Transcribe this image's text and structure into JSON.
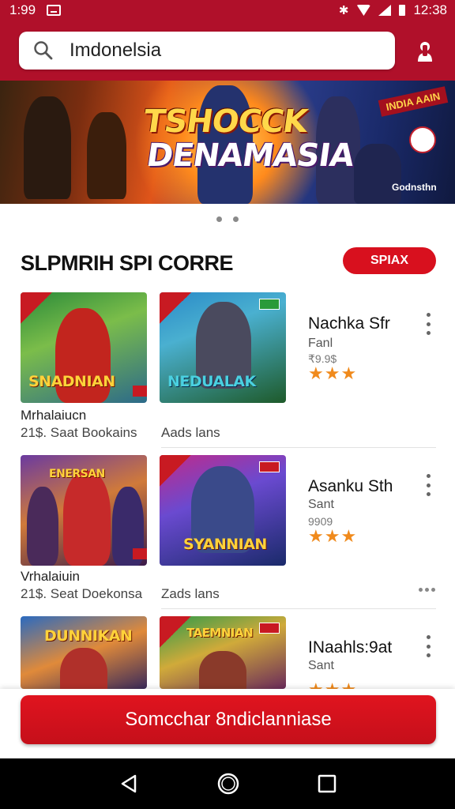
{
  "status_bar": {
    "time": "1:99",
    "right_time": "12:38"
  },
  "search": {
    "value": "Imdonelsia"
  },
  "banner": {
    "title": "TSHOCCK",
    "subtitle": "DENAMASIA",
    "tag": "INDIA AAIN",
    "logo": "Godnsthn"
  },
  "section": {
    "title": "SLPMRIH SPI CORRE",
    "button_label": "SPIAX"
  },
  "rows": [
    {
      "thumb1_title": "SNADNIAN",
      "thumb2_title": "NEDUALAK",
      "caption_title": "Mrhalaiucn",
      "caption_meta": "21$. Saat Bookains",
      "caption_meta2": "Aads lans",
      "info_title": "Nachka Sfr",
      "info_sub": "Fanl",
      "info_meta": "₹9.9$",
      "stars": "★★★"
    },
    {
      "thumb1_title": "ENERSAN",
      "thumb2_title": "SYANNIAN",
      "caption_title": "Vrhalaiuin",
      "caption_meta": "21$. Seat Doekonsa",
      "caption_meta2": "Zads lans",
      "info_title": "Asanku Sth",
      "info_sub": "Sant",
      "info_meta": "9909",
      "stars": "★★★"
    },
    {
      "thumb1_title": "DUNNIKAN",
      "thumb2_title": "TAEMNIAN",
      "info_title": "INaahls:9at",
      "info_sub": "Sant",
      "stars": "★★★"
    }
  ],
  "cta": {
    "label": "Somcchar 8ndiclanniase"
  },
  "colors": {
    "brand_red": "#b0102a",
    "button_red": "#d8101e",
    "star_orange": "#f08a1c"
  }
}
